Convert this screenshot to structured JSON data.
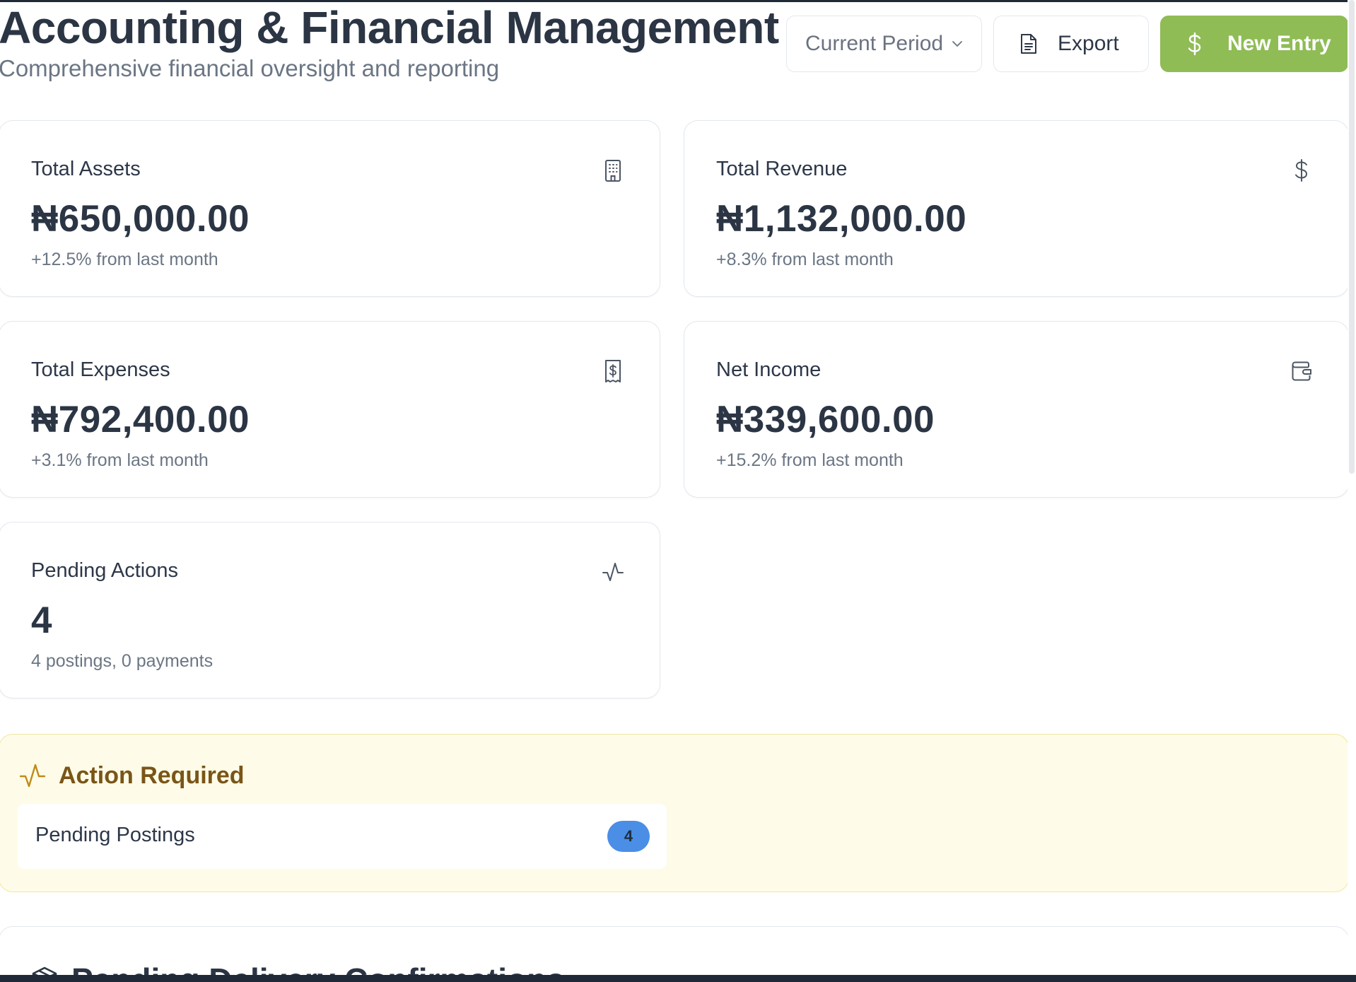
{
  "header": {
    "title": "Accounting & Financial Management",
    "subtitle": "Comprehensive financial oversight and reporting",
    "period_select": "Current Period",
    "export_label": "Export",
    "new_entry_label": "New Entry"
  },
  "cards": [
    {
      "label": "Total Assets",
      "value": "₦650,000.00",
      "note": "+12.5% from last month",
      "icon": "building-icon"
    },
    {
      "label": "Total Revenue",
      "value": "₦1,132,000.00",
      "note": "+8.3% from last month",
      "icon": "dollar-icon"
    },
    {
      "label": "Total Expenses",
      "value": "₦792,400.00",
      "note": "+3.1% from last month",
      "icon": "receipt-icon"
    },
    {
      "label": "Net Income",
      "value": "₦339,600.00",
      "note": "+15.2% from last month",
      "icon": "wallet-icon"
    },
    {
      "label": "Pending Actions",
      "value": "4",
      "note": "4 postings, 0 payments",
      "icon": "activity-icon"
    }
  ],
  "action_required": {
    "title": "Action Required",
    "items": [
      {
        "label": "Pending Postings",
        "count": "4"
      }
    ]
  },
  "delivery": {
    "title": "Pending Delivery Confirmations"
  },
  "colors": {
    "accent_green": "#8fbc55",
    "badge_blue": "#4a8ee6",
    "alert_bg": "#fefce8",
    "alert_text": "#7a5518"
  }
}
